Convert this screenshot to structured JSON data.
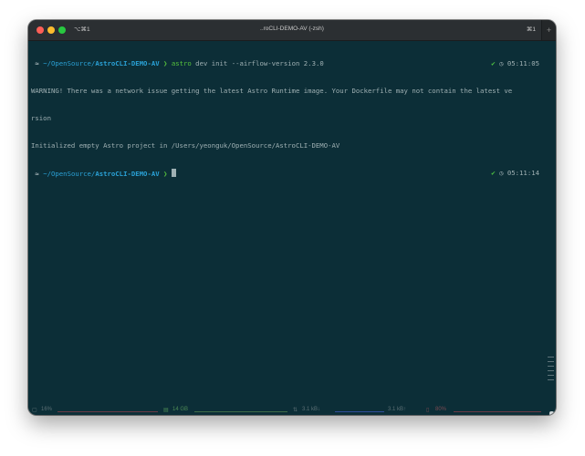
{
  "titlebar": {
    "tab_shortcut_left": "⌥⌘1",
    "title": "..roCLI-DEMO-AV (-zsh)",
    "tab_shortcut_right": "⌘1",
    "new_tab": "+"
  },
  "terminal": {
    "prompt1": {
      "apple": "",
      "arrow": "≈",
      "path": " ~/OpenSource/",
      "dir": "AstroCLI-DEMO-AV",
      "chevron": " ❯ ",
      "cmd_program": "astro",
      "cmd_args": " dev init --airflow-version 2.3.0",
      "status": "✔",
      "time": "◷ 05:11:05"
    },
    "output": [
      "WARNING! There was a network issue getting the latest Astro Runtime image. Your Dockerfile may not contain the latest ve",
      "rsion",
      "Initialized empty Astro project in /Users/yeonguk/OpenSource/AstroCLI-DEMO-AV"
    ],
    "prompt2": {
      "apple": "",
      "arrow": "≈",
      "path": " ~/OpenSource/",
      "dir": "AstroCLI-DEMO-AV",
      "chevron": " ❯ ",
      "status": "✔",
      "time": "◷ 05:11:14"
    }
  },
  "statusbar": {
    "cpu": "16%",
    "memory": "14 GB",
    "network_down": "3.1 kB↓",
    "network_up": "3.1 kB↑",
    "battery": "80%"
  },
  "colors": {
    "background": "#0c2e37",
    "path": "#2aa1d6",
    "green": "#56c23c"
  }
}
